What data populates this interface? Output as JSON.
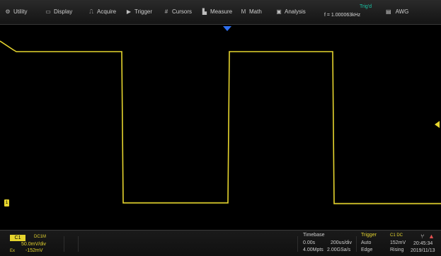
{
  "menu": [
    {
      "label": "Utility",
      "icon": "gear-icon",
      "glyph": "⚙",
      "name": "menu-utility"
    },
    {
      "label": "Display",
      "icon": "display-icon",
      "glyph": "▭",
      "name": "menu-display"
    },
    {
      "label": "Acquire",
      "icon": "acquire-icon",
      "glyph": "⎍",
      "name": "menu-acquire"
    },
    {
      "label": "Trigger",
      "icon": "trigger-icon",
      "glyph": "▶",
      "name": "menu-trigger"
    },
    {
      "label": "Cursors",
      "icon": "cursors-icon",
      "glyph": "#",
      "name": "menu-cursors"
    },
    {
      "label": "Measure",
      "icon": "measure-icon",
      "glyph": "▙",
      "name": "menu-measure"
    },
    {
      "label": "Math",
      "icon": "math-icon",
      "glyph": "M",
      "name": "menu-math"
    },
    {
      "label": "Analysis",
      "icon": "analysis-icon",
      "glyph": "▣",
      "name": "menu-analysis"
    }
  ],
  "frequency": {
    "trigger_label": "Trig'd",
    "value": "f = 1.000063kHz"
  },
  "awg": {
    "label": "AWG",
    "icon": "awg-icon",
    "glyph": "▤"
  },
  "channel": {
    "tag": "C1",
    "coupling": "DC1M",
    "scale": "50.0mV/div",
    "offset_label": "Ex",
    "offset": "-152mV",
    "marker": "1",
    "color": "#e6d52e"
  },
  "timebase": {
    "title": "Timebase",
    "delay": "0.00s",
    "scale": "200us/div",
    "memory": "4.00Mpts",
    "sample_rate": "2.00GSa/s"
  },
  "trigger": {
    "title": "Trigger",
    "source": "C1 DC",
    "mode": "Auto",
    "level": "152mV",
    "type": "Edge",
    "slope": "Rising"
  },
  "clock": {
    "time": "20:45:34",
    "date": "2019/11/13"
  },
  "colors": {
    "trace": "#e6d52e",
    "trigger_marker": "#2e6ff0",
    "trigd": "#19c7a8",
    "background": "#000000"
  }
}
